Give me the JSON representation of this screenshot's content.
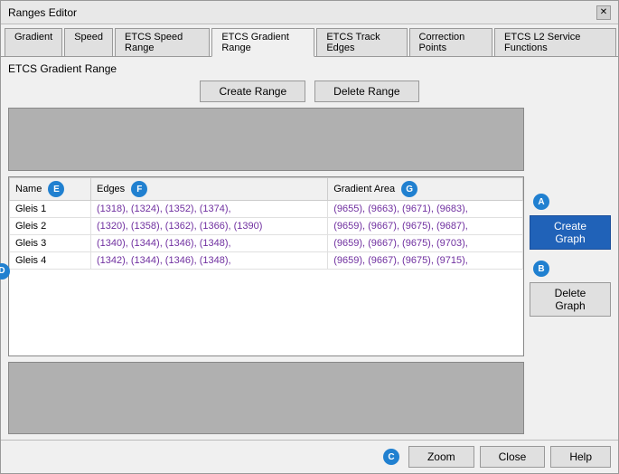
{
  "window": {
    "title": "Ranges Editor"
  },
  "tabs": [
    {
      "id": "gradient",
      "label": "Gradient",
      "active": false
    },
    {
      "id": "speed",
      "label": "Speed",
      "active": false
    },
    {
      "id": "etcs-speed-range",
      "label": "ETCS Speed Range",
      "active": false
    },
    {
      "id": "etcs-gradient-range",
      "label": "ETCS Gradient Range",
      "active": true
    },
    {
      "id": "etcs-track-edges",
      "label": "ETCS Track Edges",
      "active": false
    },
    {
      "id": "correction-points",
      "label": "Correction Points",
      "active": false
    },
    {
      "id": "etcs-l2",
      "label": "ETCS L2 Service Functions",
      "active": false
    }
  ],
  "section_label": "ETCS Gradient Range",
  "buttons": {
    "create_range": "Create Range",
    "delete_range": "Delete Range",
    "create_graph": "Create Graph",
    "delete_graph": "Delete Graph",
    "zoom": "Zoom",
    "close": "Close",
    "help": "Help"
  },
  "table": {
    "columns": [
      {
        "id": "name",
        "label": "Name",
        "badge": "E"
      },
      {
        "id": "edges",
        "label": "Edges",
        "badge": "F"
      },
      {
        "id": "gradient_area",
        "label": "Gradient Area",
        "badge": "G"
      }
    ],
    "rows": [
      {
        "name": "Gleis 1",
        "edges": "(1318), (1324), (1352), (1374),",
        "gradient_area": "(9655), (9663), (9671), (9683),"
      },
      {
        "name": "Gleis 2",
        "edges": "(1320), (1358), (1362), (1366), (1390)",
        "gradient_area": "(9659), (9667), (9675), (9687),"
      },
      {
        "name": "Gleis 3",
        "edges": "(1340), (1344), (1346), (1348),",
        "gradient_area": "(9659), (9667), (9675), (9703),"
      },
      {
        "name": "Gleis 4",
        "edges": "(1342), (1344), (1346), (1348),",
        "gradient_area": "(9659), (9667), (9675), (9715),"
      }
    ]
  },
  "badges": {
    "A": "A",
    "B": "B",
    "C": "C",
    "D": "D"
  }
}
